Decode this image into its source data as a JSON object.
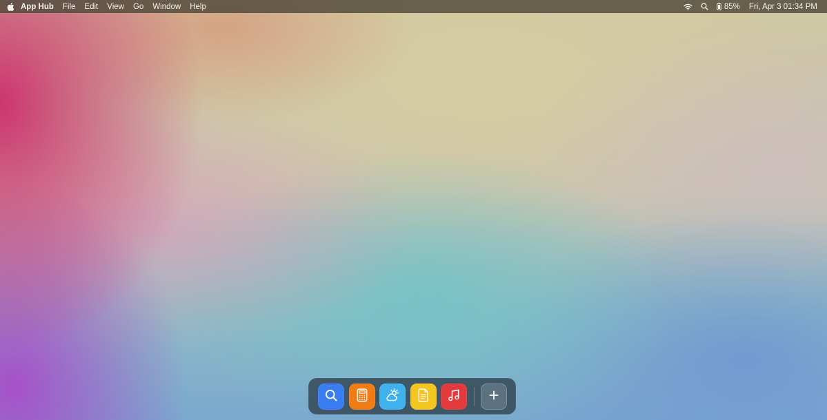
{
  "menubar": {
    "app_name": "App Hub",
    "menus": [
      "File",
      "Edit",
      "View",
      "Go",
      "Window",
      "Help"
    ],
    "status": {
      "battery": "85%",
      "clock": "Fri, Apr 3 01:34 PM"
    },
    "icons": [
      "apple-icon",
      "wifi-icon",
      "search-icon",
      "battery-icon"
    ]
  },
  "dock": {
    "apps": [
      {
        "id": "search",
        "icon": "search-icon",
        "color": "#3a7cf2"
      },
      {
        "id": "calculator",
        "icon": "calculator-icon",
        "color": "#f07c16"
      },
      {
        "id": "weather",
        "icon": "weather-icon",
        "color": "#3fb2ee"
      },
      {
        "id": "notes",
        "icon": "notes-icon",
        "color": "#f4c61f"
      },
      {
        "id": "music",
        "icon": "music-icon",
        "color": "#e33b3d"
      }
    ],
    "add_icon": "plus-icon"
  }
}
